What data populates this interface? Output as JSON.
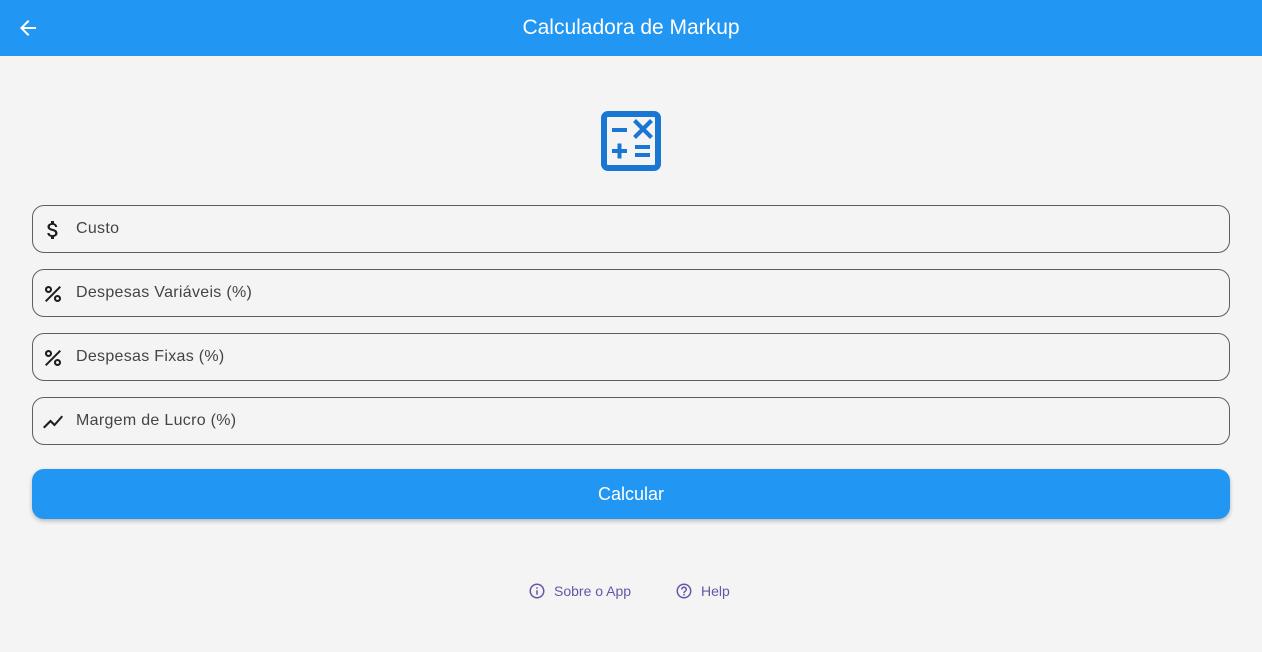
{
  "colors": {
    "primary": "#2196f3",
    "background": "#f4f4f4",
    "link": "#6a54a8",
    "icon": "#1e1e1e"
  },
  "appbar": {
    "title": "Calculadora de Markup",
    "back_icon": "arrow-back-icon"
  },
  "hero": {
    "icon": "calculate-icon"
  },
  "form": {
    "fields": [
      {
        "icon": "dollar-icon",
        "placeholder": "Custo",
        "value": ""
      },
      {
        "icon": "percent-icon",
        "placeholder": "Despesas Variáveis (%)",
        "value": ""
      },
      {
        "icon": "percent-icon",
        "placeholder": "Despesas Fixas (%)",
        "value": ""
      },
      {
        "icon": "trending-up-icon",
        "placeholder": "Margem de Lucro (%)",
        "value": ""
      }
    ],
    "submit_label": "Calcular"
  },
  "footer": {
    "about_label": "Sobre o App",
    "about_icon": "info-icon",
    "help_label": "Help",
    "help_icon": "help-icon"
  }
}
